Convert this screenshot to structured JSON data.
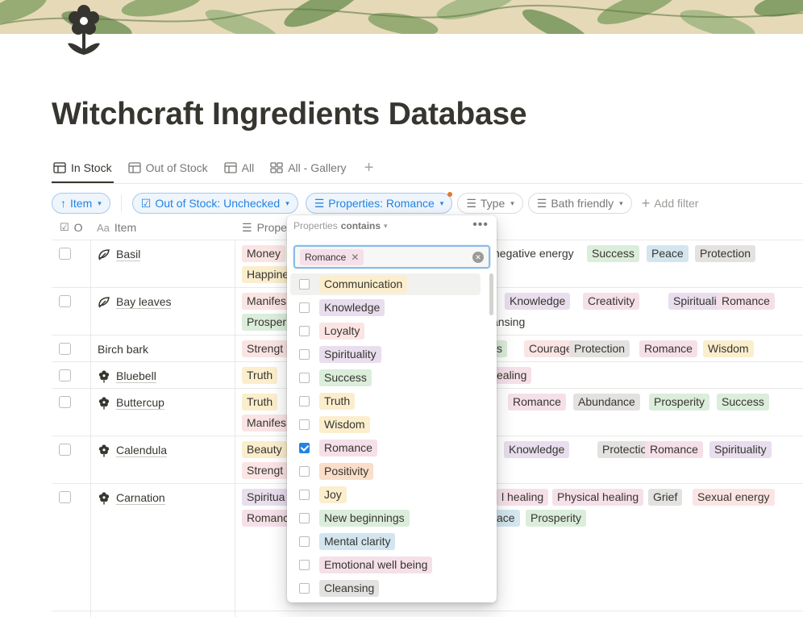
{
  "page": {
    "title": "Witchcraft Ingredients Database"
  },
  "tabs": [
    {
      "label": "In Stock",
      "icon": "table-icon",
      "active": true
    },
    {
      "label": "Out of Stock",
      "icon": "table-icon",
      "active": false
    },
    {
      "label": "All",
      "icon": "table-icon",
      "active": false
    },
    {
      "label": "All - Gallery",
      "icon": "gallery-icon",
      "active": false
    }
  ],
  "filters": {
    "sort": "Item",
    "out_of_stock": "Out of Stock: Unchecked",
    "properties": "Properties: Romance",
    "type": "Type",
    "bath": "Bath friendly",
    "add": "Add filter"
  },
  "columns": {
    "out": "O",
    "item": "Item",
    "item_prefix": "Aa",
    "properties": "Prope"
  },
  "rows": [
    {
      "name": "Basil",
      "icon": "leaf-icon",
      "tags": [
        {
          "t": "Money",
          "c": "red"
        },
        {
          "t": "negative energy",
          "c": "none"
        },
        {
          "t": "Success",
          "c": "grn"
        },
        {
          "t": "Peace",
          "c": "blu"
        },
        {
          "t": "Protection",
          "c": "gry"
        },
        {
          "t": "Happine",
          "c": "yel"
        }
      ]
    },
    {
      "name": "Bay leaves",
      "icon": "leaf-icon",
      "tags": [
        {
          "t": "Manifes",
          "c": "red"
        },
        {
          "t": "Knowledge",
          "c": "pur"
        },
        {
          "t": "Creativity",
          "c": "pnk"
        },
        {
          "t": "Spirituality",
          "c": "pur"
        },
        {
          "t": "Romance",
          "c": "pnk"
        },
        {
          "t": "Prosper",
          "c": "grn"
        },
        {
          "t": "ansing",
          "c": "none"
        }
      ]
    },
    {
      "name": "Birch bark",
      "icon": "",
      "tags": [
        {
          "t": "Strengt",
          "c": "red"
        },
        {
          "t": "s",
          "c": "grn"
        },
        {
          "t": "Courage",
          "c": "red"
        },
        {
          "t": "Protection",
          "c": "gry"
        },
        {
          "t": "Romance",
          "c": "pnk"
        },
        {
          "t": "Wisdom",
          "c": "yel"
        }
      ]
    },
    {
      "name": "Bluebell",
      "icon": "flower-icon",
      "tags": [
        {
          "t": "Truth",
          "c": "yel"
        },
        {
          "t": "ealing",
          "c": "pnk"
        }
      ]
    },
    {
      "name": "Buttercup",
      "icon": "flower-icon",
      "tags": [
        {
          "t": "Truth",
          "c": "yel"
        },
        {
          "t": "Romance",
          "c": "pnk"
        },
        {
          "t": "Abundance",
          "c": "gry"
        },
        {
          "t": "Prosperity",
          "c": "grn"
        },
        {
          "t": "Success",
          "c": "grn"
        },
        {
          "t": "Manifes",
          "c": "red"
        }
      ]
    },
    {
      "name": "Calendula",
      "icon": "flower-icon",
      "tags": [
        {
          "t": "Beauty",
          "c": "yel"
        },
        {
          "t": "Knowledge",
          "c": "pur"
        },
        {
          "t": "Protection",
          "c": "gry"
        },
        {
          "t": "Romance",
          "c": "pnk"
        },
        {
          "t": "Spirituality",
          "c": "pur"
        },
        {
          "t": "Strengt",
          "c": "red"
        }
      ]
    },
    {
      "name": "Carnation",
      "icon": "flower-icon",
      "tags": [
        {
          "t": "Spiritua",
          "c": "pur"
        },
        {
          "t": "l healing",
          "c": "pnk"
        },
        {
          "t": "Physical healing",
          "c": "pnk"
        },
        {
          "t": "Grief",
          "c": "gry"
        },
        {
          "t": "Sexual energy",
          "c": "red"
        },
        {
          "t": "Romanc",
          "c": "pnk"
        },
        {
          "t": "ace",
          "c": "blu"
        },
        {
          "t": "Prosperity",
          "c": "grn"
        }
      ]
    }
  ],
  "popup": {
    "property": "Properties",
    "operator": "contains",
    "selected_tag": "Romance",
    "options": [
      {
        "label": "Communication",
        "color": "yel",
        "checked": false
      },
      {
        "label": "Knowledge",
        "color": "pur",
        "checked": false
      },
      {
        "label": "Loyalty",
        "color": "red",
        "checked": false
      },
      {
        "label": "Spirituality",
        "color": "pur",
        "checked": false
      },
      {
        "label": "Success",
        "color": "grn",
        "checked": false
      },
      {
        "label": "Truth",
        "color": "yel",
        "checked": false
      },
      {
        "label": "Wisdom",
        "color": "yel",
        "checked": false
      },
      {
        "label": "Romance",
        "color": "pnk",
        "checked": true
      },
      {
        "label": "Positivity",
        "color": "org",
        "checked": false
      },
      {
        "label": "Joy",
        "color": "yel",
        "checked": false
      },
      {
        "label": "New beginnings",
        "color": "grn",
        "checked": false
      },
      {
        "label": "Mental clarity",
        "color": "blu",
        "checked": false
      },
      {
        "label": "Emotional well being",
        "color": "pnk",
        "checked": false
      },
      {
        "label": "Cleansing",
        "color": "gry",
        "checked": false
      }
    ]
  },
  "colors": {
    "accent": "#2383e2",
    "notification_dot": "#e3782d"
  }
}
